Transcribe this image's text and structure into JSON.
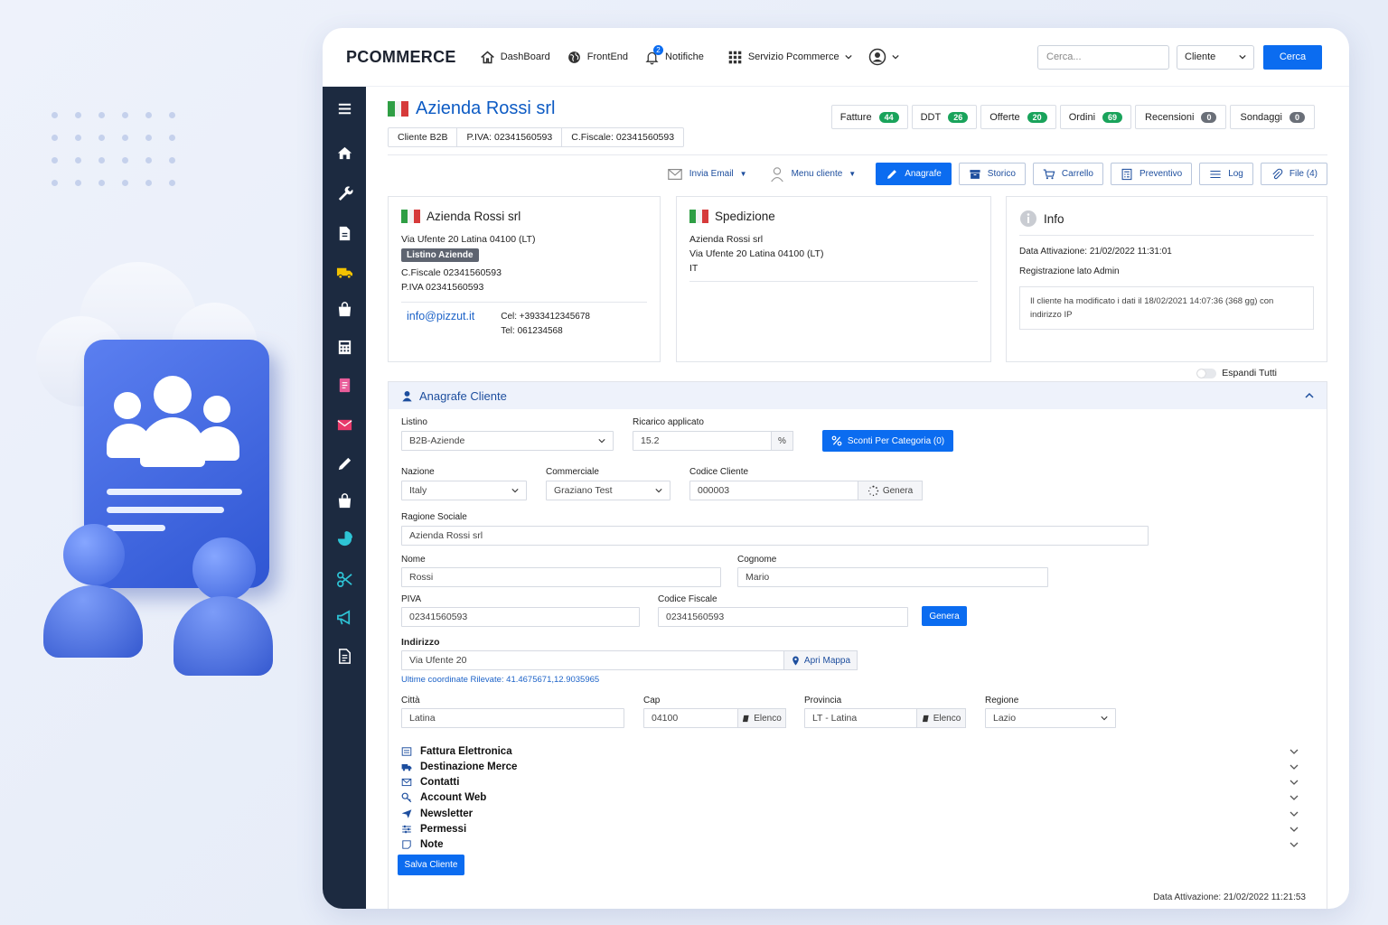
{
  "app": {
    "logo": "PCOMMERCE"
  },
  "topnav": [
    {
      "label": "DashBoard",
      "icon": "home-icon"
    },
    {
      "label": "FrontEnd",
      "icon": "globe-icon"
    },
    {
      "label": "Notifiche",
      "icon": "bell-icon",
      "badge": "2"
    },
    {
      "label": "Servizio Pcommerce",
      "icon": "grid-icon"
    }
  ],
  "search": {
    "placeholder": "Cerca...",
    "scope": "Cliente",
    "button": "Cerca"
  },
  "customer": {
    "name": "Azienda Rossi srl",
    "type": "Cliente B2B",
    "piva": "P.IVA: 02341560593",
    "cf": "C.Fiscale: 02341560593"
  },
  "counts": [
    {
      "label": "Fatture",
      "value": "44",
      "color": "#19a35b"
    },
    {
      "label": "DDT",
      "value": "26",
      "color": "#19a35b"
    },
    {
      "label": "Offerte",
      "value": "20",
      "color": "#19a35b"
    },
    {
      "label": "Ordini",
      "value": "69",
      "color": "#19a35b"
    },
    {
      "label": "Recensioni",
      "value": "0",
      "color": "#6a6f78"
    },
    {
      "label": "Sondaggi",
      "value": "0",
      "color": "#6a6f78"
    }
  ],
  "actions": {
    "email": "Invia Email",
    "menu": "Menu cliente",
    "anagrafe": "Anagrafe",
    "storico": "Storico",
    "carrello": "Carrello",
    "preventivo": "Preventivo",
    "log": "Log",
    "file": "File (4)"
  },
  "billing": {
    "name": "Azienda Rossi srl",
    "address": "Via Ufente 20 Latina 04100 (LT)",
    "listino": "Listino Aziende",
    "cf": "C.Fiscale 02341560593",
    "piva": "P.IVA 02341560593",
    "email": "info@pizzut.it",
    "cel": "Cel: +3933412345678",
    "tel": "Tel: 061234568"
  },
  "shipping": {
    "title": "Spedizione",
    "name": "Azienda Rossi srl",
    "address": "Via Ufente 20 Latina 04100 (LT)",
    "country": "IT"
  },
  "info": {
    "title": "Info",
    "activation": "Data Attivazione: 21/02/2022 11:31:01",
    "registration": "Registrazione lato Admin",
    "note": "Il cliente ha modificato i dati il 18/02/2021 14:07:36 (368 gg) con indirizzo IP"
  },
  "expand_all": "Espandi Tutti",
  "form": {
    "title": "Anagrafe Cliente",
    "listino_label": "Listino",
    "listino": "B2B-Aziende",
    "ricarico_label": "Ricarico applicato",
    "ricarico": "15.2",
    "percent": "%",
    "sconti": "Sconti Per Categoria (0)",
    "nazione_label": "Nazione",
    "nazione": "Italy",
    "commerciale_label": "Commerciale",
    "commerciale": "Graziano Test",
    "codice_label": "Codice Cliente",
    "codice": "000003",
    "genera": "Genera",
    "ragione_label": "Ragione Sociale",
    "ragione": "Azienda Rossi srl",
    "nome_label": "Nome",
    "nome": "Rossi",
    "cognome_label": "Cognome",
    "cognome": "Mario",
    "piva_label": "PIVA",
    "piva": "02341560593",
    "cf_label": "Codice Fiscale",
    "cf": "02341560593",
    "genera_cf": "Genera",
    "indirizzo_label": "Indirizzo",
    "indirizzo": "Via Ufente 20",
    "mappa": "Apri Mappa",
    "coords": "Ultime coordinate Rilevate: 41.4675671,12.9035965",
    "citta_label": "Città",
    "citta": "Latina",
    "cap_label": "Cap",
    "cap": "04100",
    "elenco": "Elenco",
    "provincia_label": "Provincia",
    "provincia": "LT - Latina",
    "regione_label": "Regione",
    "regione": "Lazio",
    "sections": [
      "Fattura Elettronica",
      "Destinazione Merce",
      "Contatti",
      "Account Web",
      "Newsletter",
      "Permessi",
      "Note"
    ],
    "save": "Salva Cliente"
  },
  "footer": {
    "activation": "Data Attivazione: 21/02/2022 11:21:53"
  },
  "colors": {
    "accent": "#0b6cf0",
    "sidebar": "#1c2a40",
    "title": "#0d5bc4"
  }
}
